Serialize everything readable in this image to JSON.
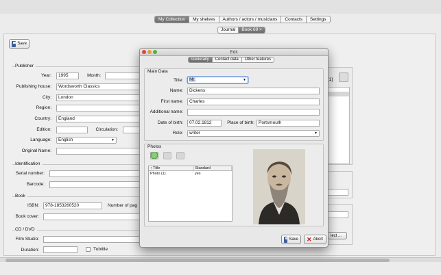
{
  "nav": {
    "tabs": [
      "My Collection",
      "My shelves",
      "Authors / actors / musicians",
      "Contacts",
      "Settings"
    ],
    "active_tab": "My Collection",
    "doc_tabs": [
      "Journal",
      "Book 69"
    ],
    "doc_tab_close": "×"
  },
  "toolbar": {
    "save_label": "Save"
  },
  "publisher": {
    "title": "Publisher",
    "year_label": "Year:",
    "year_value": "1995",
    "month_label": "Month:",
    "house_label": "Publishing house:",
    "house_value": "Wordsworth Classics",
    "city_label": "City:",
    "city_value": "London",
    "region_label": "Region:",
    "country_label": "Country:",
    "country_value": "England",
    "edition_label": "Edition:",
    "circulation_label": "Circulation:",
    "language_label": "Language:",
    "language_value": "English",
    "original_name_label": "Original Name:"
  },
  "identification": {
    "title": "Identification",
    "serial_label": "Serial number:",
    "barcode_label": "Barcode:"
  },
  "book": {
    "title": "Book",
    "isbn_label": "ISBN:",
    "isbn_value": "978-1853260520",
    "pages_label": "Number of pag",
    "cover_label": "Book cover:"
  },
  "cd": {
    "title": "CD / DVD",
    "studio_label": "Film Studio:",
    "duration_label": "Duration:",
    "subtitle_label": "Tubtitle"
  },
  "right_panel": {
    "count_text": "[1]",
    "select_button": "lect ..."
  },
  "dialog": {
    "title": "Edit",
    "tabs": [
      "Generally",
      "Contact data",
      "Other features"
    ],
    "active_tab": "Generally",
    "main_data": {
      "title": "Main Data",
      "title_label": "Title:",
      "title_value": "Mr.",
      "name_label": "Name:",
      "name_value": "Dickens",
      "first_label": "First name:",
      "first_value": "Charles",
      "additional_label": "Additional name:",
      "dob_label": "Date of birth:",
      "dob_value": "07.02.1812",
      "pob_label": "Place of birth:",
      "pob_value": "Portsmouth",
      "role_label": "Role:",
      "role_value": "writer"
    },
    "photos": {
      "title": "Photos",
      "columns": [
        "↑ Title",
        "Standard"
      ],
      "rows": [
        {
          "title": "Photo (1)",
          "standard": "yes"
        }
      ]
    },
    "save_label": "Save",
    "abort_label": "Abort"
  },
  "colors": {
    "accent_tab": "#7a7a7a",
    "dialog_bg": "#e8e8e8"
  }
}
